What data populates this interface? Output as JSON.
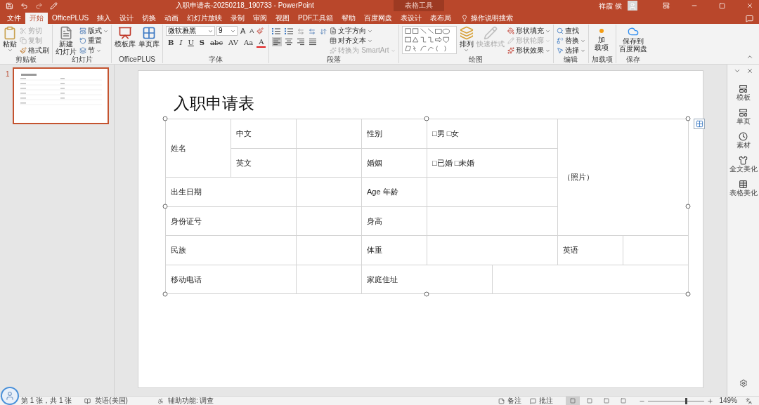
{
  "title_bar": {
    "title": "入职申请表-20250218_190733  -  PowerPoint",
    "context_label": "表格工具",
    "user": "祥霞 侯"
  },
  "tabs": [
    {
      "label": "文件",
      "selected": false
    },
    {
      "label": "开始",
      "selected": true
    },
    {
      "label": "OfficePLUS",
      "selected": false
    },
    {
      "label": "插入",
      "selected": false
    },
    {
      "label": "设计",
      "selected": false
    },
    {
      "label": "切换",
      "selected": false
    },
    {
      "label": "动画",
      "selected": false
    },
    {
      "label": "幻灯片放映",
      "selected": false
    },
    {
      "label": "录制",
      "selected": false
    },
    {
      "label": "审阅",
      "selected": false
    },
    {
      "label": "视图",
      "selected": false
    },
    {
      "label": "PDF工具箱",
      "selected": false
    },
    {
      "label": "帮助",
      "selected": false
    },
    {
      "label": "百度网盘",
      "selected": false
    },
    {
      "label": "表设计",
      "selected": false
    },
    {
      "label": "表布局",
      "selected": false
    }
  ],
  "tell_me": "操作说明搜索",
  "ribbon": {
    "clipboard": {
      "label": "剪贴板",
      "paste": "粘贴",
      "items": [
        {
          "label": "剪切",
          "disabled": true
        },
        {
          "label": "复制",
          "disabled": true
        },
        {
          "label": "格式刷",
          "disabled": false
        }
      ]
    },
    "slides": {
      "label": "幻灯片",
      "new_slide_lines": [
        "新建",
        "幻灯片"
      ],
      "items": [
        "版式",
        "重置",
        "节"
      ]
    },
    "officeplus": {
      "label": "OfficePLUS",
      "items": [
        "模板库",
        "单页库"
      ]
    },
    "font": {
      "label": "字体",
      "font_name": "微软雅黑",
      "font_size": "9",
      "size_glyphs": [
        "A",
        "A"
      ],
      "glyphs": [
        {
          "text": "B",
          "kind": "bold"
        },
        {
          "text": "I",
          "kind": "italic"
        },
        {
          "text": "U",
          "kind": "underline"
        },
        {
          "text": "S",
          "kind": "shadow"
        },
        {
          "text": "abc",
          "kind": "strike"
        },
        {
          "text": "AV",
          "kind": "spacing"
        },
        {
          "text": "Aa",
          "kind": "case"
        },
        {
          "text": "A",
          "kind": "color"
        }
      ]
    },
    "paragraph": {
      "label": "段落",
      "alignments": [
        {
          "selected": true
        },
        {
          "selected": false
        },
        {
          "selected": false
        },
        {
          "selected": false
        }
      ],
      "items": [
        {
          "label": "文字方向",
          "disabled": false
        },
        {
          "label": "对齐文本",
          "disabled": false
        },
        {
          "label": "转换为 SmartArt",
          "disabled": true
        }
      ]
    },
    "drawing": {
      "label": "绘图",
      "arrange": "排列",
      "quick_styles": {
        "label": "快速样式",
        "disabled": true
      },
      "items": [
        {
          "label": "形状填充",
          "disabled": false
        },
        {
          "label": "形状轮廓",
          "disabled": true
        },
        {
          "label": "形状效果",
          "disabled": false
        }
      ]
    },
    "editing": {
      "label": "编辑",
      "items": [
        "查找",
        "替换",
        "选择"
      ]
    },
    "addins": {
      "label": "加载项",
      "button_lines": [
        "加",
        "载项"
      ]
    },
    "save": {
      "label": "保存",
      "button_lines": [
        "保存到",
        "百度网盘"
      ]
    }
  },
  "slide_panel": {
    "slides": [
      {
        "number": "1",
        "selected": true
      }
    ]
  },
  "slide": {
    "title": "入职申请表",
    "table": {
      "rows": [
        [
          {
            "text": "姓名",
            "rowspan": 2
          },
          {
            "text": "中文"
          },
          {},
          {
            "text": "性别"
          },
          {
            "text": "□男 □女",
            "colspan": 2
          },
          {
            "text": "（照片）",
            "colspan": 2,
            "rowspan": 4
          }
        ],
        [
          {
            "text": "英文"
          },
          {},
          {
            "text": "婚姻"
          },
          {
            "text": "□已婚 □未婚",
            "colspan": 2
          }
        ],
        [
          {
            "text": "出生日期",
            "colspan": 2
          },
          {},
          {
            "text": "Age 年龄"
          },
          {
            "colspan": 2
          }
        ],
        [
          {
            "text": "身份证号",
            "colspan": 2
          },
          {},
          {
            "text": "身高"
          },
          {
            "colspan": 2
          }
        ],
        [
          {
            "text": "民族",
            "colspan": 2
          },
          {},
          {
            "text": "体重"
          },
          {
            "colspan": 2
          },
          {
            "text": "英语"
          },
          {}
        ],
        [
          {
            "text": "移动电话",
            "colspan": 2
          },
          {},
          {
            "text": "家庭住址",
            "colspan": 2
          },
          {
            "colspan": 3
          }
        ]
      ]
    }
  },
  "right_pane": {
    "items": [
      "模板",
      "单页",
      "素材",
      "全文美化",
      "表格美化"
    ]
  },
  "status_bar": {
    "slide_info": "第 1 张，共 1 张",
    "language": "英语(美国)",
    "accessibility": "辅助功能: 调查",
    "notes": "备注",
    "comments": "批注",
    "views": [
      {
        "selected": true
      },
      {
        "selected": false
      },
      {
        "selected": false
      },
      {
        "selected": false
      }
    ],
    "zoom_slider": {
      "level": 0.66
    },
    "zoom": "149%"
  }
}
